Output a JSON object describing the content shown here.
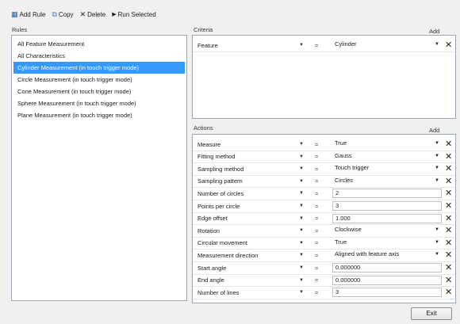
{
  "toolbar": {
    "add_rule": "Add Rule",
    "copy": "Copy",
    "delete": "Delete",
    "run_selected": "Run Selected"
  },
  "rules": {
    "label": "Rules",
    "items": [
      "All Feature Measurement",
      "All Characteristics",
      "Cylinder Measurement (in touch trigger mode)",
      "Circle Measurement (in touch trigger mode)",
      "Cone Measurement (in touch trigger mode)",
      "Sphere Measurement (in touch trigger mode)",
      "Plane Measurement (in touch trigger mode)"
    ],
    "selected_index": 2
  },
  "criteria": {
    "label": "Criteria",
    "add_label": "Add",
    "rows": [
      {
        "name": "Feature",
        "op": "=",
        "value": "Cylinder",
        "kind": "dropdown"
      }
    ]
  },
  "actions": {
    "label": "Actions",
    "add_label": "Add",
    "rows": [
      {
        "name": "Measure",
        "op": "=",
        "value": "True",
        "kind": "dropdown"
      },
      {
        "name": "Fitting method",
        "op": "=",
        "value": "Gauss",
        "kind": "dropdown"
      },
      {
        "name": "Sampling method",
        "op": "=",
        "value": "Touch trigger",
        "kind": "dropdown"
      },
      {
        "name": "Sampling pattern",
        "op": "=",
        "value": "Circles",
        "kind": "dropdown"
      },
      {
        "name": "Number of circles",
        "op": "=",
        "value": "2",
        "kind": "text"
      },
      {
        "name": "Points per circle",
        "op": "=",
        "value": "3",
        "kind": "text"
      },
      {
        "name": "Edge offset",
        "op": "=",
        "value": "1.000",
        "kind": "text"
      },
      {
        "name": "Rotation",
        "op": "=",
        "value": "Clockwise",
        "kind": "dropdown"
      },
      {
        "name": "Circular movement",
        "op": "=",
        "value": "True",
        "kind": "dropdown"
      },
      {
        "name": "Measurement direction",
        "op": "=",
        "value": "Aligned with feature axis",
        "kind": "dropdown"
      },
      {
        "name": "Start angle",
        "op": "=",
        "value": "0.000000",
        "kind": "text"
      },
      {
        "name": "End angle",
        "op": "=",
        "value": "0.000000",
        "kind": "text"
      },
      {
        "name": "Number of lines",
        "op": "=",
        "value": "3",
        "kind": "text"
      }
    ]
  },
  "footer": {
    "exit_label": "Exit"
  }
}
